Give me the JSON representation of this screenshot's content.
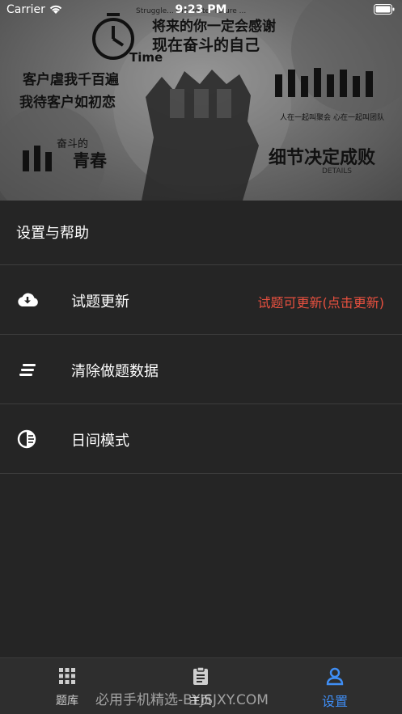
{
  "status": {
    "carrier": "Carrier",
    "time": "9:23 PM"
  },
  "banner": {
    "top_en": "Struggle... the better future ...",
    "line1": "将来的你一定会感谢",
    "line2": "现在奋斗的自己",
    "time_word": "Time",
    "left1": "客户虐我千百遍",
    "left2": "我待客户如初恋",
    "left3": "奋斗的",
    "left4": "青春",
    "right1": "人在一起叫聚会",
    "right2": "心在一起叫团队",
    "right3": "细节决定成败",
    "right4": "DETAILS"
  },
  "settings": {
    "title": "设置与帮助",
    "items": [
      {
        "label": "试题更新",
        "note": "试题可更新(点击更新)",
        "icon": "cloud-download-icon"
      },
      {
        "label": "清除做题数据",
        "note": "",
        "icon": "clear-lines-icon"
      },
      {
        "label": "日间模式",
        "note": "",
        "icon": "contrast-icon"
      }
    ]
  },
  "tabs": [
    {
      "label": "题库",
      "icon": "grid-icon",
      "active": false
    },
    {
      "label": "主页",
      "icon": "clipboard-icon",
      "active": false
    },
    {
      "label": "设置",
      "icon": "person-icon",
      "active": true
    }
  ],
  "watermark": "必用手机精选-BYJSJXY.COM",
  "colors": {
    "background": "#252525",
    "accent": "#3f8ef5",
    "update_note": "#e8503f"
  }
}
